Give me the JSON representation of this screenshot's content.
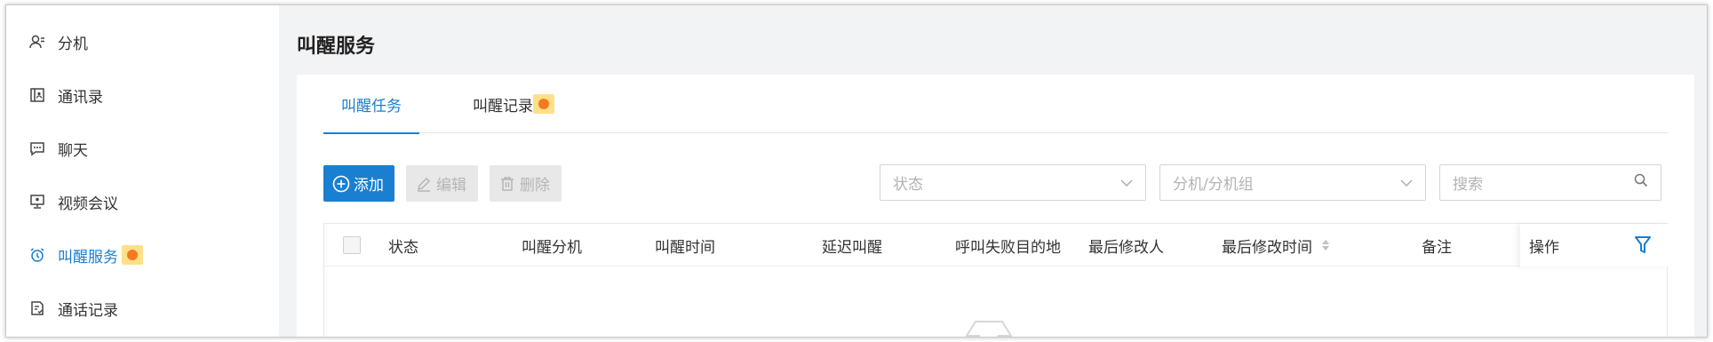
{
  "sidebar": {
    "items": [
      {
        "label": "分机",
        "icon": "extension-user-icon",
        "active": false
      },
      {
        "label": "通讯录",
        "icon": "contacts-book-icon",
        "active": false
      },
      {
        "label": "聊天",
        "icon": "chat-icon",
        "active": false
      },
      {
        "label": "视频会议",
        "icon": "video-conference-icon",
        "active": false
      },
      {
        "label": "叫醒服务",
        "icon": "alarm-clock-icon",
        "active": true,
        "badge": true
      },
      {
        "label": "通话记录",
        "icon": "call-log-icon",
        "active": false
      }
    ]
  },
  "page": {
    "title": "叫醒服务"
  },
  "tabs": [
    {
      "label": "叫醒任务",
      "active": true
    },
    {
      "label": "叫醒记录",
      "active": false,
      "badge": true
    }
  ],
  "toolbar": {
    "add_label": "添加",
    "edit_label": "编辑",
    "delete_label": "删除",
    "status_placeholder": "状态",
    "extension_placeholder": "分机/分机组",
    "search_placeholder": "搜索"
  },
  "table": {
    "columns": [
      "状态",
      "叫醒分机",
      "叫醒时间",
      "延迟叫醒",
      "呼叫失败目的地",
      "最后修改人",
      "最后修改时间",
      "备注",
      "操作"
    ],
    "rows": []
  },
  "colors": {
    "accent": "#1a7fd0",
    "badge_bg": "#ffe08a",
    "badge_dot": "#f47a20"
  }
}
